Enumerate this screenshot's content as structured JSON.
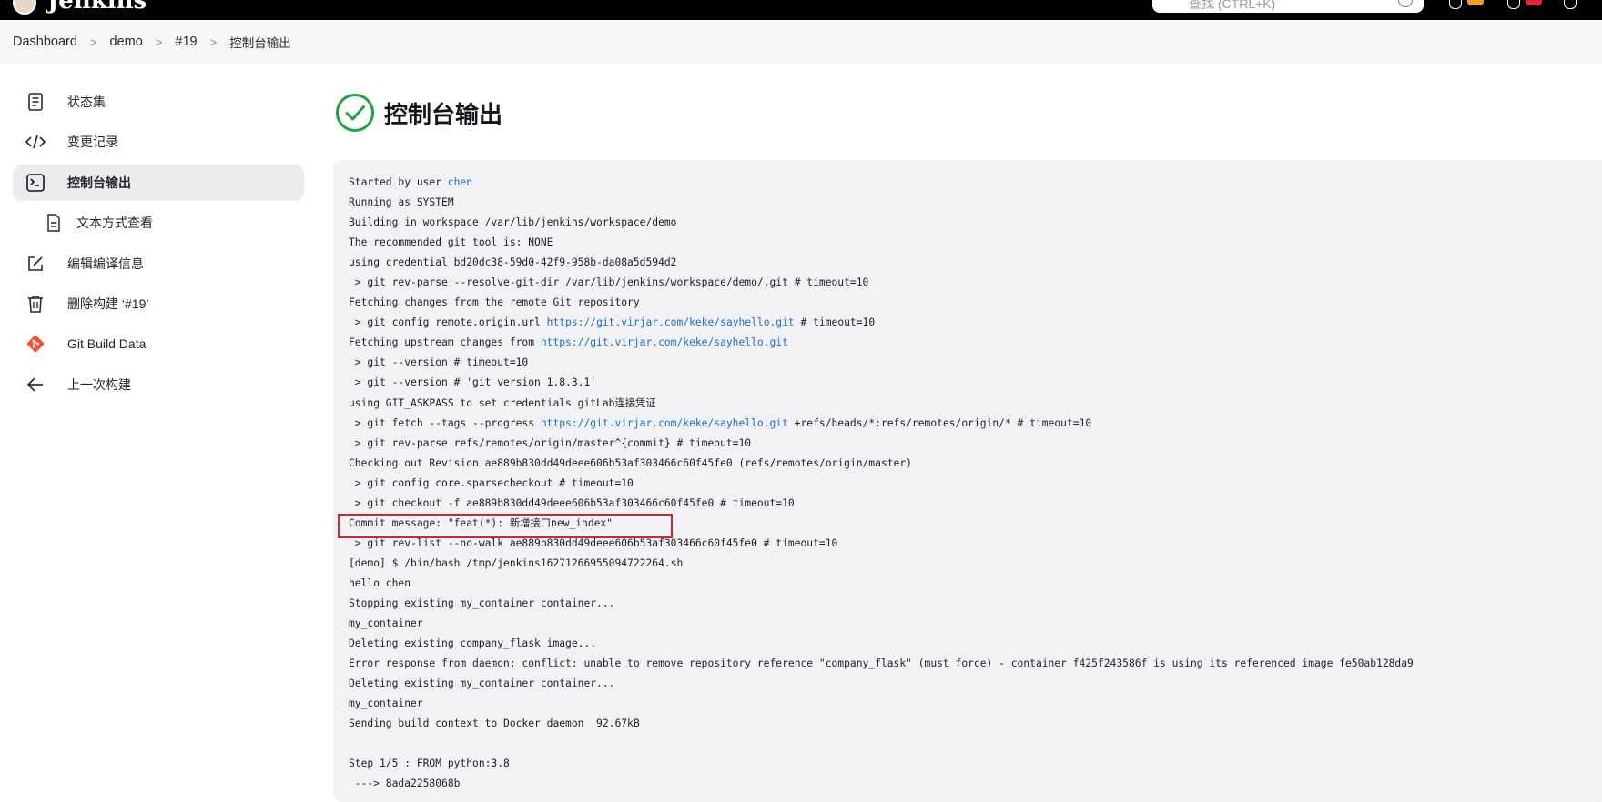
{
  "header": {
    "logo_text": "Jenkins",
    "search_placeholder": "查找 (CTRL+K)",
    "search_icon": "search-icon",
    "help_icon": "help-icon"
  },
  "breadcrumb": [
    "Dashboard",
    "demo",
    "#19",
    "控制台输出"
  ],
  "sidebar": {
    "items": [
      {
        "label": "状态集",
        "icon": "document-icon"
      },
      {
        "label": "变更记录",
        "icon": "code-icon"
      },
      {
        "label": "控制台输出",
        "icon": "terminal-icon"
      },
      {
        "label": "文本方式查看",
        "icon": "file-icon"
      },
      {
        "label": "编辑编译信息",
        "icon": "edit-icon"
      },
      {
        "label": "删除构建 ‘#19’",
        "icon": "trash-icon"
      },
      {
        "label": "Git Build Data",
        "icon": "git-icon"
      },
      {
        "label": "上一次构建",
        "icon": "arrow-left-icon"
      }
    ]
  },
  "page_title": "控制台输出",
  "console": {
    "lines": [
      {
        "pre": "Started by user ",
        "link": "chen",
        "post": ""
      },
      {
        "pre": "Running as SYSTEM"
      },
      {
        "pre": "Building in workspace /var/lib/jenkins/workspace/demo"
      },
      {
        "pre": "The recommended git tool is: NONE"
      },
      {
        "pre": "using credential bd20dc38-59d0-42f9-958b-da08a5d594d2"
      },
      {
        "pre": " > git rev-parse --resolve-git-dir /var/lib/jenkins/workspace/demo/.git # timeout=10"
      },
      {
        "pre": "Fetching changes from the remote Git repository"
      },
      {
        "pre": " > git config remote.origin.url ",
        "link": "https://git.virjar.com/keke/sayhello.git",
        "post": " # timeout=10"
      },
      {
        "pre": "Fetching upstream changes from ",
        "link": "https://git.virjar.com/keke/sayhello.git",
        "post": ""
      },
      {
        "pre": " > git --version # timeout=10"
      },
      {
        "pre": " > git --version # 'git version 1.8.3.1'"
      },
      {
        "pre": "using GIT_ASKPASS to set credentials gitLab连接凭证"
      },
      {
        "pre": " > git fetch --tags --progress ",
        "link": "https://git.virjar.com/keke/sayhello.git",
        "post": " +refs/heads/*:refs/remotes/origin/* # timeout=10"
      },
      {
        "pre": " > git rev-parse refs/remotes/origin/master^{commit} # timeout=10"
      },
      {
        "pre": "Checking out Revision ae889b830dd49deee606b53af303466c60f45fe0 (refs/remotes/origin/master)"
      },
      {
        "pre": " > git config core.sparsecheckout # timeout=10"
      },
      {
        "pre": " > git checkout -f ae889b830dd49deee606b53af303466c60f45fe0 # timeout=10"
      },
      {
        "pre": "Commit message: \"feat(*): 新增接口new_index\""
      },
      {
        "pre": " > git rev-list --no-walk ae889b830dd49deee606b53af303466c60f45fe0 # timeout=10"
      },
      {
        "pre": "[demo] $ /bin/bash /tmp/jenkins16271266955094722264.sh"
      },
      {
        "pre": "hello chen"
      },
      {
        "pre": "Stopping existing my_container container..."
      },
      {
        "pre": "my_container"
      },
      {
        "pre": "Deleting existing company_flask image..."
      },
      {
        "pre": "Error response from daemon: conflict: unable to remove repository reference \"company_flask\" (must force) - container f425f243586f is using its referenced image fe50ab128da9"
      },
      {
        "pre": "Deleting existing my_container container..."
      },
      {
        "pre": "my_container"
      },
      {
        "pre": "Sending build context to Docker daemon  92.67kB"
      },
      {
        "pre": ""
      },
      {
        "pre": "Step 1/5 : FROM python:3.8"
      },
      {
        "pre": " ---> 8ada2258068b"
      }
    ]
  },
  "colors": {
    "topbar": "#000000",
    "breadcrumb_bg": "#f7f7f8",
    "console_bg": "#f2f2f4",
    "link": "#1b6fd0",
    "success": "#1ea446",
    "highlight": "#d5252a"
  }
}
